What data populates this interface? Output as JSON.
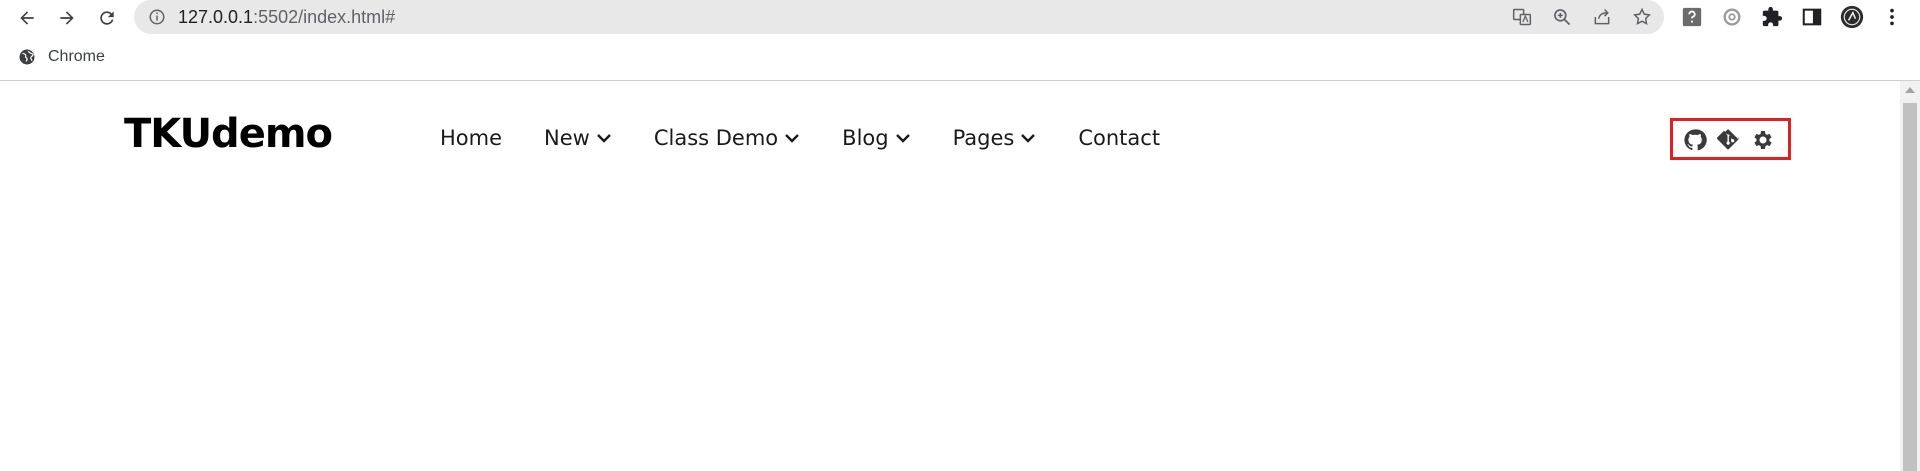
{
  "browser": {
    "url_host": "127.0.0.1",
    "url_rest": ":5502/index.html#",
    "bookmark_label": "Chrome"
  },
  "site": {
    "logo": "TKUdemo",
    "nav": [
      {
        "label": "Home",
        "dropdown": false
      },
      {
        "label": "New",
        "dropdown": true
      },
      {
        "label": "Class Demo",
        "dropdown": true
      },
      {
        "label": "Blog",
        "dropdown": true
      },
      {
        "label": "Pages",
        "dropdown": true
      },
      {
        "label": "Contact",
        "dropdown": false
      }
    ],
    "header_icons": [
      "github-icon",
      "git-icon",
      "gear-icon"
    ],
    "highlight_color": "#e02020"
  }
}
